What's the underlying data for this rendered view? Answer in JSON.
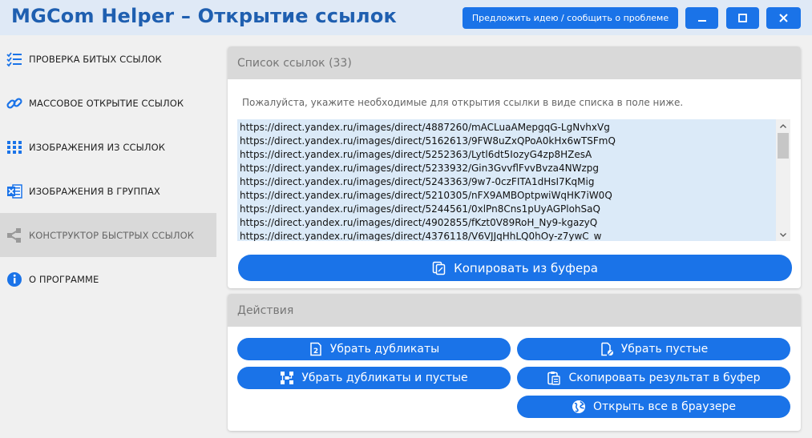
{
  "header": {
    "title": "MGCom Helper – Открытие ссылок",
    "feedback_label": "Предложить идею / сообщить о проблеме",
    "minimize_icon": "minimize-icon",
    "maximize_icon": "maximize-icon",
    "close_icon": "close-icon",
    "accent": "#1a73e8"
  },
  "sidebar": {
    "items": [
      {
        "label": "ПРОВЕРКА БИТЫХ ССЫЛОК",
        "icon": "checklist-icon"
      },
      {
        "label": "МАССОВОЕ ОТКРЫТИЕ ССЫЛОК",
        "icon": "link-icon"
      },
      {
        "label": "ИЗОБРАЖЕНИЯ ИЗ ССЫЛОК",
        "icon": "grid-icon"
      },
      {
        "label": "ИЗОБРАЖЕНИЯ В ГРУППАХ",
        "icon": "excel-icon"
      },
      {
        "label": "КОНСТРУКТОР БЫСТРЫХ ССЫЛОК",
        "icon": "share-icon"
      },
      {
        "label": "О ПРОГРАММЕ",
        "icon": "info-icon"
      }
    ],
    "active_index": 4
  },
  "links_panel": {
    "title": "Список ссылок (33)",
    "hint": "Пожалуйста, укажите необходимые для открытия ссылки в виде списка в поле ниже.",
    "lines": [
      "https://direct.yandex.ru/images/direct/4887260/mACLuaAMepgqG-LgNvhxVg",
      "https://direct.yandex.ru/images/direct/5162613/9FW8uZxQPoA0kHx6wTSFmQ",
      "https://direct.yandex.ru/images/direct/5252363/Lytl6dt5IozyG4zp8HZesA",
      "https://direct.yandex.ru/images/direct/5233932/Gin3GvvflFvvBvza4NWzpg",
      "https://direct.yandex.ru/images/direct/5243363/9w7-0czFITA1dHsI7KqMig",
      "https://direct.yandex.ru/images/direct/5210305/nFX9AMBOptpwiWqHK7iW0Q",
      "https://direct.yandex.ru/images/direct/5244561/0xlPn8Cns1pUyAGPlohSaQ",
      "https://direct.yandex.ru/images/direct/4902855/fKzt0V89RoH_Ny9-kgazyQ",
      "https://direct.yandex.ru/images/direct/4376118/V6VJJqHhLQ0hOy-z7ywC_w"
    ],
    "paste_label": "Копировать из буфера",
    "textarea_bg": "#dbeaf8"
  },
  "actions_panel": {
    "title": "Действия",
    "buttons": {
      "remove_duplicates": "Убрать дубликаты",
      "remove_empty": "Убрать пустые",
      "remove_both": "Убрать дубликаты и пустые",
      "copy_result": "Скопировать результат в буфер",
      "open_all": "Открыть все в браузере"
    }
  }
}
